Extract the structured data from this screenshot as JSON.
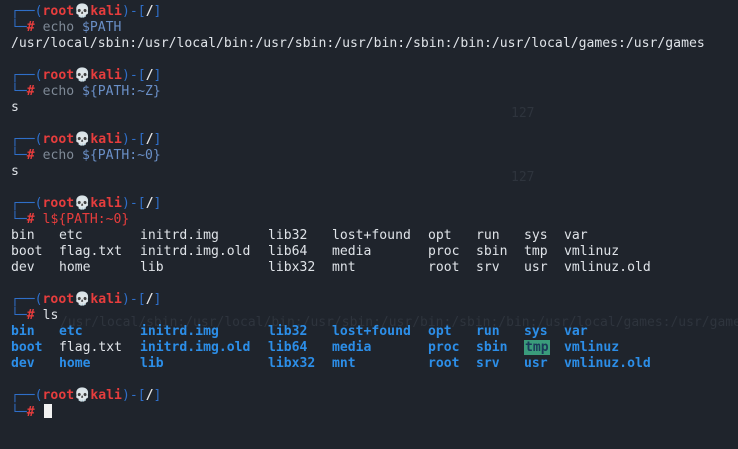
{
  "prompt": {
    "top_left": "┌──(",
    "user": "root",
    "skull": "💀",
    "host": "kali",
    "mid": ")-[",
    "cwd": "/",
    "close": "]",
    "bottom_left": "└─",
    "symbol": "#"
  },
  "blocks": [
    {
      "command_prefix": "echo ",
      "command_var": "$PATH",
      "output": "/usr/local/sbin:/usr/local/bin:/usr/sbin:/usr/bin:/sbin:/bin:/usr/local/games:/usr/games"
    },
    {
      "command_prefix": "echo ",
      "command_var": "${PATH:~Z}",
      "output": "s"
    },
    {
      "command_prefix": "echo ",
      "command_var": "${PATH:~0}",
      "output": "s"
    },
    {
      "command_prefix": "l",
      "command_var": "${PATH:~0}"
    },
    {
      "command_prefix": "ls",
      "command_var": ""
    }
  ],
  "listing": {
    "rows": [
      [
        "bin",
        "etc",
        "initrd.img",
        "lib32",
        "lost+found",
        "opt",
        "run",
        "sys",
        "var"
      ],
      [
        "boot",
        "flag.txt",
        "initrd.img.old",
        "lib64",
        "media",
        "proc",
        "sbin",
        "tmp",
        "vmlinuz"
      ],
      [
        "dev",
        "home",
        "lib",
        "libx32",
        "mnt",
        "root",
        "srv",
        "usr",
        "vmlinuz.old"
      ]
    ],
    "non_dir_entries": [
      "flag.txt"
    ],
    "highlighted_entries": [
      "tmp"
    ]
  },
  "ghost_text": {
    "num1": "127",
    "num2": "127",
    "path": "/usr/local/sbin:/usr/local/bin:/usr/sbin:/usr/bin:/sbin:/bin:/usr/local/games:/usr/games"
  },
  "colors": {
    "background": "#1f242c",
    "prompt_frame": "#2f6fc9",
    "prompt_user": "#e63d3d",
    "directory": "#2c8ee8",
    "highlight_bg": "#3a9b7b"
  }
}
